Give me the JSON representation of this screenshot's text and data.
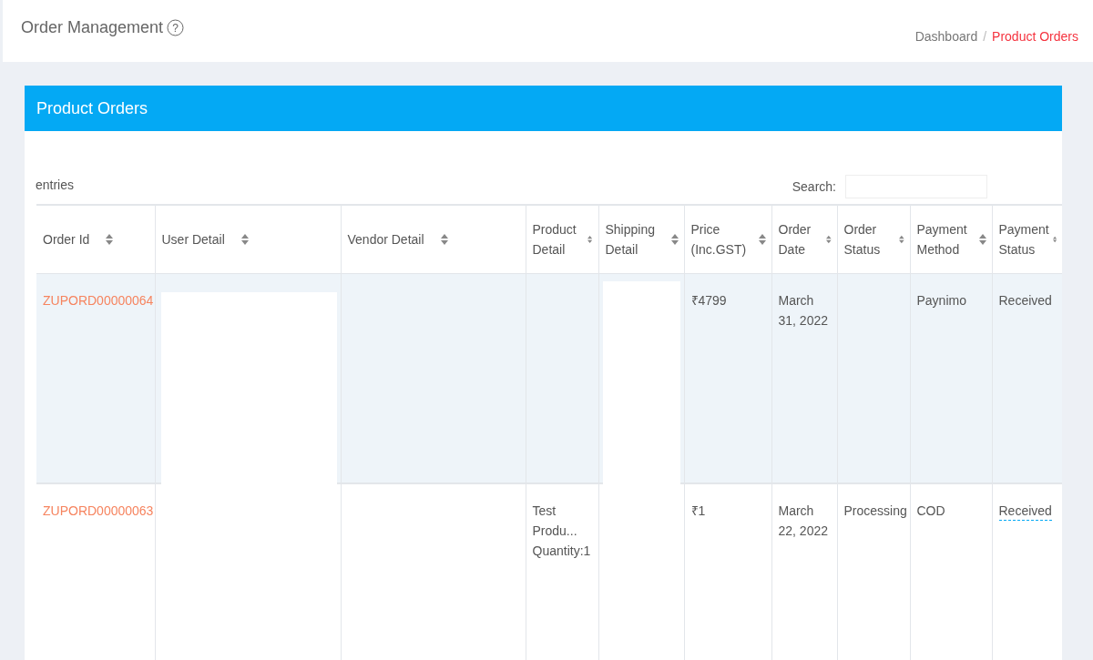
{
  "header": {
    "title": "Order Management",
    "help": "?",
    "separator": "/",
    "breadcrumb": [
      {
        "label": "Dashboard",
        "selected": false
      },
      {
        "label": "Product Orders",
        "selected": true
      }
    ]
  },
  "card": {
    "title": "Product Orders",
    "entries_label": "entries",
    "search": {
      "label": "Search:"
    }
  },
  "table": {
    "columns": [
      "Order Id",
      "User Detail",
      "Vendor Detail",
      "Product Detail",
      "Shipping Detail",
      "Price (Inc.GST)",
      "Order Date",
      "Order Status",
      "Payment Method",
      "Payment Status"
    ],
    "rows": [
      {
        "striped": true,
        "order_id": "ZUPORD00000064",
        "product_detail": [],
        "price": "₹4799",
        "order_date": "March 31, 2022",
        "payment_method": "Paynimo",
        "payment_status": "Received",
        "status_tooltip": false
      },
      {
        "striped": false,
        "order_id": "ZUPORD00000063",
        "product_detail": [
          "Test Produ...",
          "Quantity:1"
        ],
        "price": "₹1",
        "order_date": "March 22, 2022",
        "order_status": "Processing",
        "payment_method": "COD",
        "payment_status": "Received",
        "status_tooltip": true
      }
    ]
  }
}
